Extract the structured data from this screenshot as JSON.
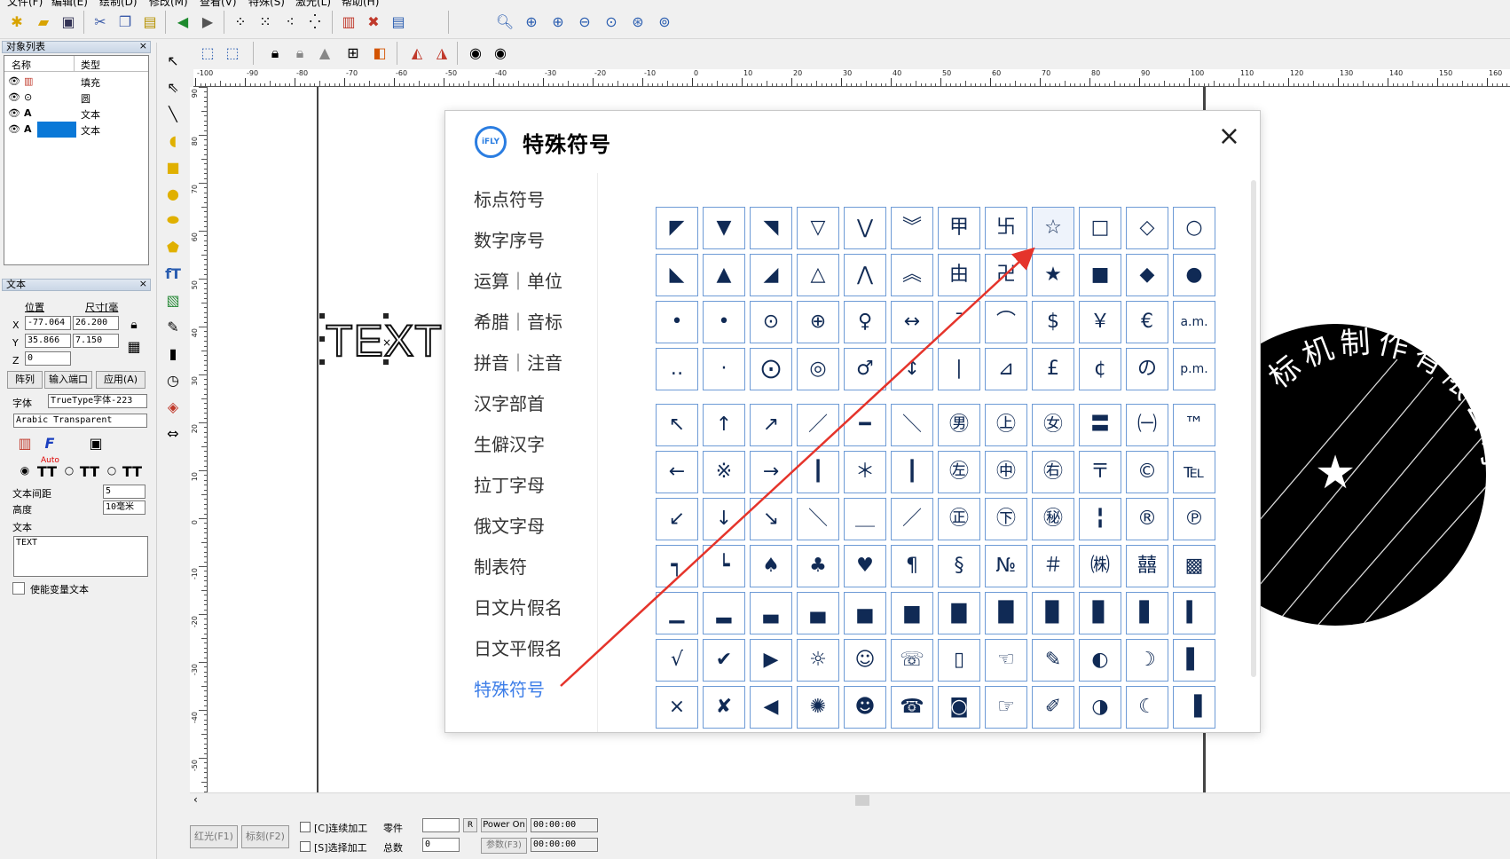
{
  "menu": [
    "文件(F)",
    "编辑(E)",
    "绘制(D)",
    "修改(M)",
    "查看(V)",
    "特殊(S)",
    "激光(L)",
    "帮助(H)"
  ],
  "obj_panel": {
    "title": "对象列表",
    "close": "×",
    "col_name": "名称",
    "col_type": "类型",
    "rows": [
      {
        "name": "",
        "type": "填充"
      },
      {
        "name": "",
        "type": "圆"
      },
      {
        "name": "A",
        "type": "文本"
      },
      {
        "name": "A",
        "type": "文本"
      }
    ]
  },
  "text_panel": {
    "title": "文本",
    "close": "×",
    "pos_label": "位置",
    "size_label": "尺寸[毫",
    "x_label": "X",
    "y_label": "Y",
    "z_label": "Z",
    "x_value": "-77.064",
    "y_value": "35.866",
    "z_value": "0",
    "w_value": "26.200",
    "h_value": "7.150",
    "btn_array": "阵列",
    "btn_port": "输入端口",
    "btn_apply": "应用(A)",
    "font_label": "字体",
    "font_type": "TrueType字体-223",
    "font_name": "Arabic Transparent",
    "auto_label": "Auto",
    "spacing_label": "文本间距",
    "spacing_value": "5",
    "height_label": "高度",
    "height_value": "10毫米",
    "text_label": "文本",
    "text_value": "TEXT",
    "var_label": "使能变量文本"
  },
  "canvas": {
    "sample_text": "TEXT",
    "ruler_h": [
      "-100",
      "-90",
      "-80",
      "-70",
      "-60",
      "-50",
      "-40",
      "-30",
      "-20",
      "-10",
      "0",
      "10",
      "20",
      "30",
      "40",
      "50",
      "60",
      "70",
      "80",
      "90",
      "100",
      "110",
      "120",
      "130",
      "140",
      "150",
      "160"
    ],
    "ruler_v": [
      "90",
      "80",
      "70",
      "60",
      "50",
      "40",
      "30",
      "20",
      "10",
      "0",
      "-10",
      "-20",
      "-30",
      "-40",
      "-50"
    ]
  },
  "status": {
    "btn_red": "红光(F1)",
    "btn_mark": "标刻(F2)",
    "chk_continuous": "[C]连续加工",
    "chk_select": "[S]选择加工",
    "part_label": "零件",
    "total_label": "总数",
    "total_value": "0",
    "r_button": "R",
    "power_label": "Power On",
    "param_button": "参数(F3)",
    "time1": "00:00:00",
    "time2": "00:00:00"
  },
  "modal": {
    "logo_text": "iFLY",
    "title": "特殊符号",
    "close": "×",
    "categories": [
      "标点符号",
      "数字序号",
      "运算｜单位",
      "希腊｜音标",
      "拼音｜注音",
      "汉字部首",
      "生僻汉字",
      "拉丁字母",
      "俄文字母",
      "制表符",
      "日文片假名",
      "日文平假名",
      "特殊符号"
    ],
    "active_category": "特殊符号",
    "grid1": [
      "◤",
      "▼",
      "◥",
      "▽",
      "⋁",
      "︾",
      "甲",
      "卐",
      "☆",
      "□",
      "◇",
      "○",
      "◣",
      "▲",
      "◢",
      "△",
      "⋀",
      "︽",
      "由",
      "卍",
      "★",
      "■",
      "◆",
      "●",
      "•",
      "•",
      "⊙",
      "⊕",
      "♀",
      "↔",
      "¯",
      "⌒",
      "$",
      "￥",
      "€",
      "a.m.",
      "‥",
      "·",
      "⨀",
      "◎",
      "♂",
      "↕",
      "∣",
      "⊿",
      "£",
      "¢",
      "の",
      "p.m."
    ],
    "grid2": [
      "↖",
      "↑",
      "↗",
      "／",
      "━",
      "＼",
      "㊚",
      "㊤",
      "㊛",
      "〓",
      "㈠",
      "™",
      "←",
      "※",
      "→",
      "┃",
      "＊",
      "┃",
      "㊧",
      "㊥",
      "㊨",
      "〒",
      "©",
      "℡",
      "↙",
      "↓",
      "↘",
      "＼",
      "＿",
      "／",
      "㊣",
      "㊦",
      "㊙",
      "╏",
      "®",
      "℗",
      "┑",
      "┕",
      "♠",
      "♣",
      "♥",
      "¶",
      "§",
      "№",
      "＃",
      "㈱",
      "囍",
      "▩",
      "▁",
      "▂",
      "▃",
      "▄",
      "▅",
      "▆",
      "▇",
      "█",
      "▉",
      "▊",
      "▋",
      "▍",
      "√",
      "✔",
      "▶",
      "☼",
      "☺",
      "☏",
      "▯",
      "☜",
      "✎",
      "◐",
      "☽",
      "▌",
      "×",
      "✘",
      "◀",
      "✺",
      "☻",
      "☎",
      "◙",
      "☞",
      "✐",
      "◑",
      "☾",
      "▐"
    ]
  },
  "seal": {
    "text": "标机制作有限公司",
    "star": "★"
  },
  "colors": {
    "accent": "#3d7ee8",
    "grid_border": "#6e9bd6",
    "arrow": "#e5342b"
  }
}
